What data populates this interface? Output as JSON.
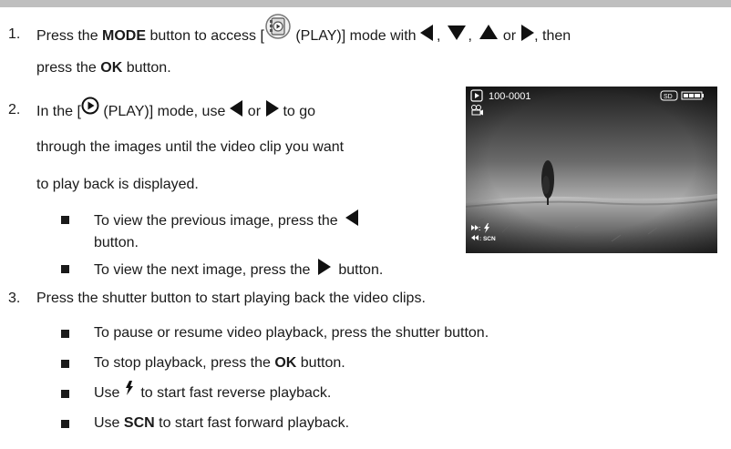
{
  "step1": {
    "number": "1.",
    "text_a": "Press the ",
    "bold_mode": "MODE",
    "text_b": " button to access [",
    "text_c": " (PLAY)] mode with ",
    "sep1": ",",
    "sep2": ",",
    "or": "or",
    "text_d": ", then",
    "line2_a": "press the ",
    "bold_ok": "OK",
    "line2_b": " button."
  },
  "step2": {
    "number": "2.",
    "line1_a": "In the [",
    "line1_b": " (PLAY)] mode, use ",
    "or": "or",
    "line1_c": " to go",
    "line2": "through the images until the video clip you want",
    "line3": "to play back is displayed.",
    "bullet1_a": "To view the previous image, press the",
    "bullet1_b": "button.",
    "bullet2_a": "To view the next image, press the",
    "bullet2_b": "button."
  },
  "step3": {
    "number": "3.",
    "text": "Press the shutter button to start playing back the video clips.",
    "bullets": [
      {
        "a": "To pause or resume video playback, press the shutter button."
      },
      {
        "a": "To stop playback, press the ",
        "bold": "OK",
        "b": " button."
      },
      {
        "a": "Use ",
        "b": " to start fast reverse playback."
      },
      {
        "a": "Use ",
        "bold": "SCN",
        "b": " to start fast forward playback."
      }
    ]
  },
  "camera_screen": {
    "file_number": "100-0001",
    "card": "SD",
    "ff_label": ": ",
    "rew_label": ": SCN"
  },
  "icons": {
    "mode_play_icon": "mode-dial-play-icon",
    "play_icon": "play-circle-icon",
    "left": "triangle-left-icon",
    "right": "triangle-right-icon",
    "up": "triangle-up-icon",
    "down": "triangle-down-icon",
    "flash": "flash-icon"
  }
}
